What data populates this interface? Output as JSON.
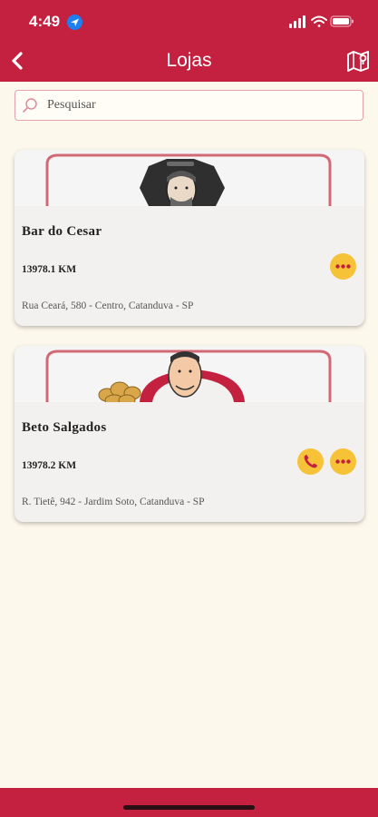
{
  "status_bar": {
    "time": "4:49"
  },
  "header": {
    "title": "Lojas"
  },
  "search": {
    "placeholder": "Pesquisar"
  },
  "stores": [
    {
      "name": "Bar do Cesar",
      "distance": "13978.1 KM",
      "address": "Rua Ceará, 580 - Centro, Catanduva - SP"
    },
    {
      "name": "Beto Salgados",
      "distance": "13978.2 KM",
      "address": "R. Tietê, 942 - Jardim Soto, Catanduva - SP"
    }
  ],
  "colors": {
    "brand_red": "#c4203f",
    "background": "#fdf8ec",
    "accent_yellow": "#f6c238",
    "card": "#f3f1ef"
  },
  "icons": [
    "back-arrow-icon",
    "map-icon",
    "search-icon",
    "phone-icon",
    "more-dots-icon"
  ]
}
